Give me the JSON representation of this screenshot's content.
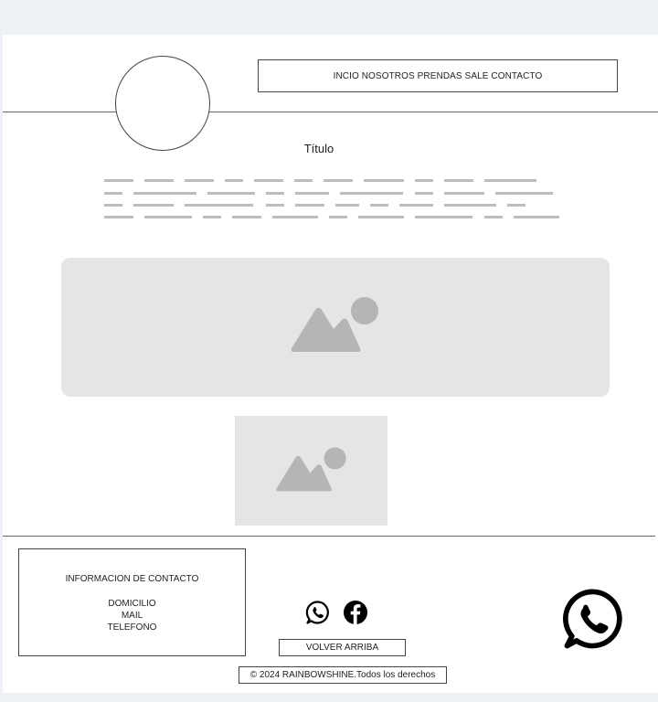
{
  "header": {
    "nav_text": "INCIO NOSOTROS PRENDAS SALE CONTACTO",
    "logo_icon": "circle-logo-placeholder"
  },
  "main": {
    "title": "Título",
    "text_placeholder_lines": 4,
    "image_large_icon": "image-placeholder-icon",
    "image_small_icon": "image-placeholder-icon"
  },
  "footer": {
    "contact": {
      "heading": "INFORMACION DE CONTACTO",
      "items": [
        "DOMICILIO",
        "MAIL",
        "TELEFONO"
      ]
    },
    "social_icons": [
      "whatsapp-icon",
      "facebook-icon"
    ],
    "back_to_top_label": "VOLVER ARRIBA",
    "copyright": "© 2024 RAINBOWSHINE.Todos los derechos",
    "whatsapp_float_icon": "whatsapp-icon"
  },
  "colors": {
    "page_bg": "#eef2f6",
    "canvas_bg": "#ffffff",
    "placeholder_bg": "#e5e5e5",
    "placeholder_shape": "#b5b5b5",
    "border": "#444444"
  }
}
